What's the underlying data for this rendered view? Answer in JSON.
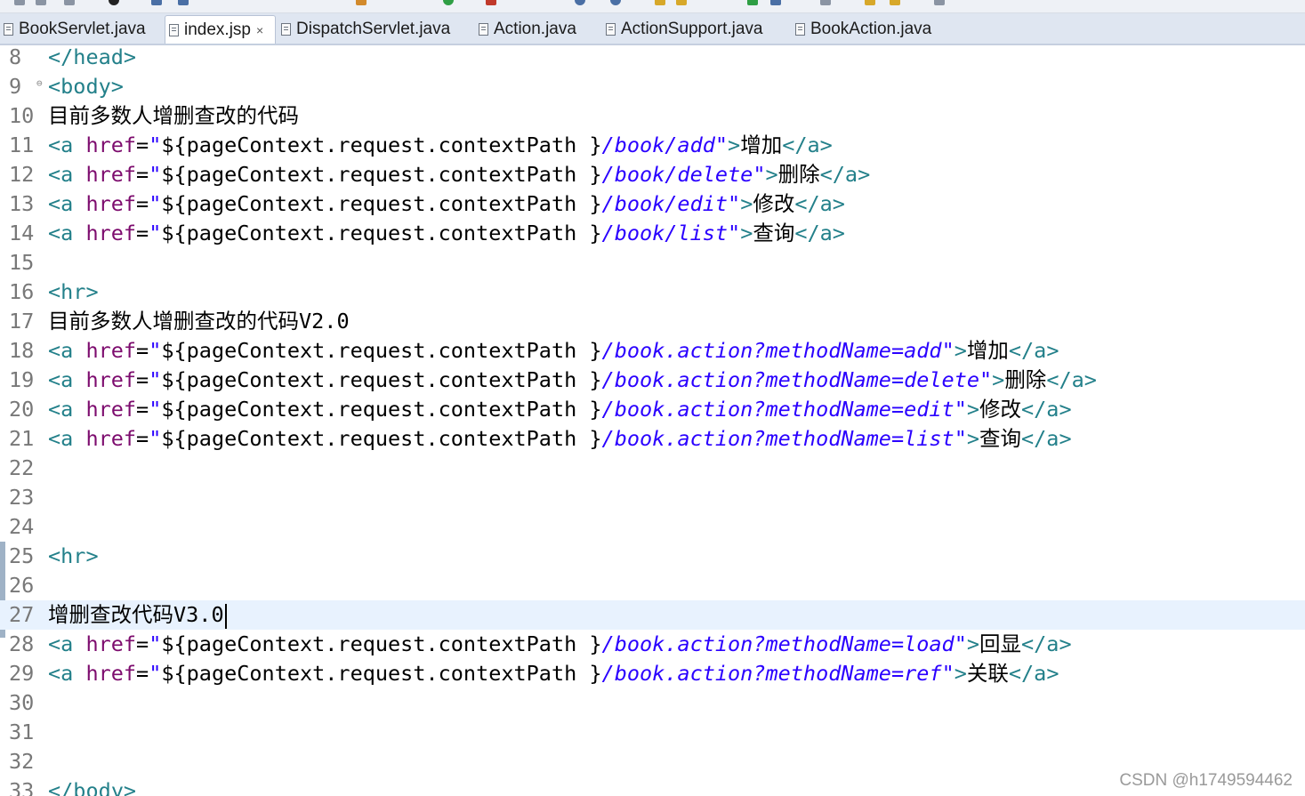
{
  "tabs": [
    {
      "label": "BookServlet.java",
      "active": false
    },
    {
      "label": "index.jsp",
      "active": true,
      "close": "×"
    },
    {
      "label": "DispatchServlet.java",
      "active": false
    },
    {
      "label": "Action.java",
      "active": false
    },
    {
      "label": "ActionSupport.java",
      "active": false
    },
    {
      "label": "BookAction.java",
      "active": false
    }
  ],
  "colors": {
    "tag": "#23808a",
    "attribute": "#7d0c6e",
    "string": "#2a00ff",
    "current_line": "#e8f2fe"
  },
  "icons": [
    "file-icon",
    "close-icon",
    "fold-marker-icon"
  ],
  "editor": {
    "current_line": 27,
    "lines": [
      {
        "num": "8"
      },
      {
        "num": "9",
        "fold": "⊖"
      },
      {
        "num": "10"
      },
      {
        "num": "11"
      },
      {
        "num": "12"
      },
      {
        "num": "13"
      },
      {
        "num": "14"
      },
      {
        "num": "15"
      },
      {
        "num": "16"
      },
      {
        "num": "17"
      },
      {
        "num": "18"
      },
      {
        "num": "19"
      },
      {
        "num": "20"
      },
      {
        "num": "21"
      },
      {
        "num": "22"
      },
      {
        "num": "23"
      },
      {
        "num": "24"
      },
      {
        "num": "25"
      },
      {
        "num": "26"
      },
      {
        "num": "27"
      },
      {
        "num": "28"
      },
      {
        "num": "29"
      },
      {
        "num": "30"
      },
      {
        "num": "31"
      },
      {
        "num": "32"
      },
      {
        "num": "33"
      }
    ]
  },
  "code": {
    "t_head_close": "</head>",
    "t_body_open": "<body>",
    "t_body_close": "</body>",
    "t_hr": "<hr>",
    "t_a_open": "<a ",
    "t_a_close": "</a>",
    "t_gt": ">",
    "attr_href": "href",
    "eq": "=",
    "quote": "\"",
    "expr": "${pageContext.request.contextPath }",
    "heading_v1": "目前多数人增删查改的代码",
    "heading_v2_text": "目前多数人增删查改的代码",
    "heading_v2_version": "V2.0",
    "heading_v3_text": "增删查改代码",
    "heading_v3_version": "V3.0",
    "links": [
      {
        "url": "/book/add",
        "label": "增加"
      },
      {
        "url": "/book/delete",
        "label": "删除"
      },
      {
        "url": "/book/edit",
        "label": "修改"
      },
      {
        "url": "/book/list",
        "label": "查询"
      },
      {
        "url": "/book.action?methodName=add",
        "label": "增加"
      },
      {
        "url": "/book.action?methodName=delete",
        "label": "删除"
      },
      {
        "url": "/book.action?methodName=edit",
        "label": "修改"
      },
      {
        "url": "/book.action?methodName=list",
        "label": "查询"
      },
      {
        "url": "/book.action?methodName=load",
        "label": "回显"
      },
      {
        "url": "/book.action?methodName=ref",
        "label": "关联"
      }
    ]
  },
  "watermark": "CSDN @h1749594462"
}
